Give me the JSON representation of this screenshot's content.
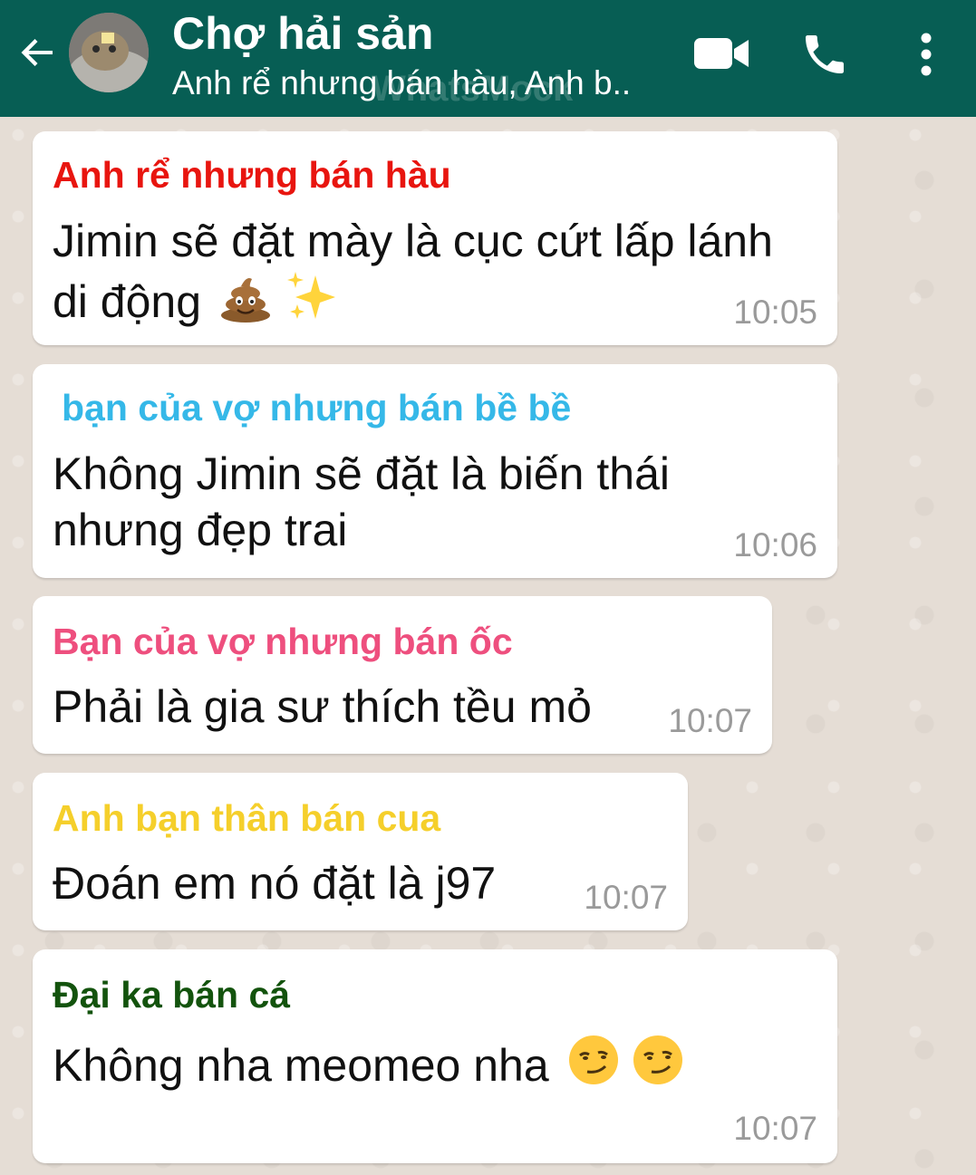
{
  "header": {
    "title": "Chợ hải sản",
    "subtitle": "Anh rể nhưng bán hàu, Anh b..",
    "watermark": "WhatsMock",
    "bg_color": "#075e54",
    "icons": [
      "back-arrow-icon",
      "group-avatar",
      "video-call-icon",
      "phone-icon",
      "more-vert-icon"
    ]
  },
  "messages": [
    {
      "sender": "Anh rể nhưng bán hàu",
      "sender_color": "#e8150f",
      "lines": [
        "Jimin sẽ đặt mày là cục cứt lấp lánh",
        "di động"
      ],
      "emojis": [
        "poop-emoji",
        "sparkles-emoji"
      ],
      "time": "10:05"
    },
    {
      "sender": "bạn của vợ nhưng bán bề bề",
      "sender_color": "#35b8e8",
      "lines": [
        "Không Jimin sẽ đặt là biến thái",
        "nhưng đẹp trai"
      ],
      "time": "10:06"
    },
    {
      "sender": "Bạn của vợ nhưng bán ốc",
      "sender_color": "#ee4f7e",
      "lines": [
        "Phải là gia sư thích tều mỏ"
      ],
      "time": "10:07"
    },
    {
      "sender": "Anh bạn thân bán cua",
      "sender_color": "#f5cf2b",
      "lines": [
        "Đoán em nó đặt là j97"
      ],
      "time": "10:07"
    },
    {
      "sender": "Đại ka bán cá",
      "sender_color": "#13530d",
      "lines": [
        "Không nha meomeo nha"
      ],
      "emojis": [
        "smirk-emoji",
        "smirk-emoji"
      ],
      "time": "10:07"
    }
  ]
}
